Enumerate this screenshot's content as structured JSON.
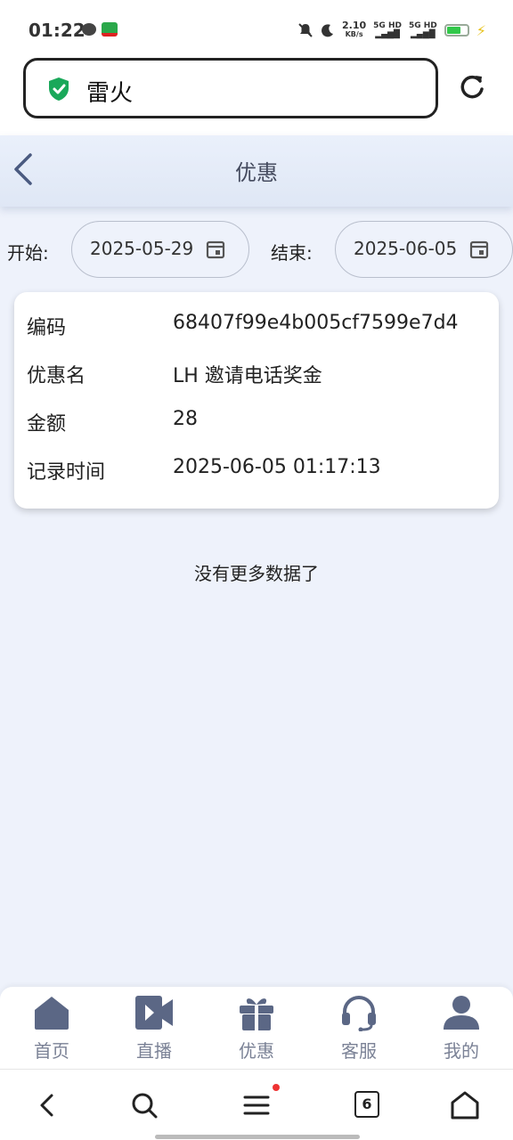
{
  "status": {
    "time": "01:22",
    "net_speed_value": "2.10",
    "net_speed_unit": "KB/s",
    "sim1": "5G HD",
    "sim2": "5G HD",
    "battery_level": 0.7
  },
  "browser": {
    "address": "雷火"
  },
  "header": {
    "title": "优惠"
  },
  "filter": {
    "start_label": "开始:",
    "start_value": "2025-05-29",
    "end_label": "结束:",
    "end_value": "2025-06-05"
  },
  "record": {
    "rows": [
      {
        "key": "编码",
        "value": "68407f99e4b005cf7599e7d4"
      },
      {
        "key": "优惠名",
        "value": "LH 邀请电话奖金"
      },
      {
        "key": "金额",
        "value": "28"
      },
      {
        "key": "记录时间",
        "value": "2025-06-05 01:17:13"
      }
    ]
  },
  "list_footer": "没有更多数据了",
  "tabs": [
    {
      "label": "首页",
      "icon": "home-icon"
    },
    {
      "label": "直播",
      "icon": "video-camera-icon"
    },
    {
      "label": "优惠",
      "icon": "gift-icon"
    },
    {
      "label": "客服",
      "icon": "headset-icon"
    },
    {
      "label": "我的",
      "icon": "user-icon"
    }
  ],
  "browser_nav": {
    "tab_count": "6"
  },
  "colors": {
    "page_bg": "#eef2fb",
    "tab_icon": "#5b6785",
    "shield": "#1aa85a"
  }
}
